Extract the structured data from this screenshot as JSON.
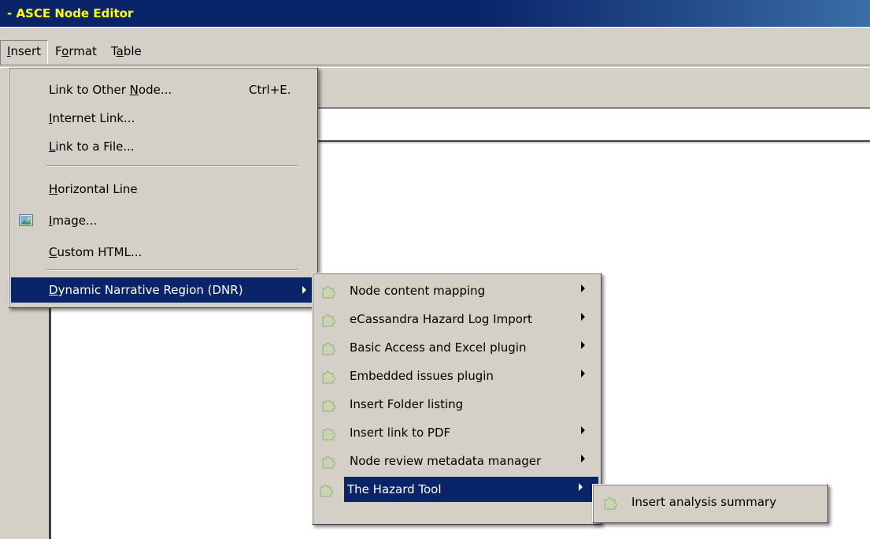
{
  "window": {
    "title": "- ASCE Node Editor"
  },
  "menubar": [
    {
      "label": "Insert",
      "mnemonic": "I",
      "rest": "nsert",
      "open": true
    },
    {
      "label": "Format",
      "pre": "F",
      "mnemonic": "o",
      "rest": "rmat",
      "open": false
    },
    {
      "label": "Table",
      "pre": "T",
      "mnemonic": "a",
      "rest": "ble",
      "open": false
    }
  ],
  "insert_menu": {
    "items": [
      {
        "pre": "Link to Other ",
        "mn": "N",
        "post": "ode...",
        "shortcut": "Ctrl+E."
      },
      {
        "pre": "",
        "mn": "I",
        "post": "nternet Link..."
      },
      {
        "pre": "",
        "mn": "L",
        "post": "ink to a File..."
      },
      {
        "pre": "",
        "mn": "H",
        "post": "orizontal Line"
      },
      {
        "pre": "",
        "mn": "I",
        "post": "mage...",
        "icon": "image-icon"
      },
      {
        "pre": "",
        "mn": "C",
        "post": "ustom HTML..."
      },
      {
        "pre": "",
        "mn": "D",
        "post": "ynamic Narrative Region (DNR)",
        "submenu": true,
        "selected": true
      }
    ]
  },
  "dnr_submenu": {
    "items": [
      {
        "label": "Node content mapping",
        "submenu": true
      },
      {
        "label": "eCassandra Hazard Log Import",
        "submenu": true
      },
      {
        "label": "Basic Access and Excel plugin",
        "submenu": true
      },
      {
        "label": "Embedded issues plugin",
        "submenu": true
      },
      {
        "label": "Insert Folder listing",
        "submenu": false
      },
      {
        "label": "Insert link to PDF",
        "submenu": true
      },
      {
        "label": "Node review metadata manager",
        "submenu": true
      },
      {
        "label": "The Hazard Tool",
        "submenu": true,
        "selected": true
      }
    ],
    "icon": "puzzle-plugin-icon"
  },
  "hazard_submenu": {
    "items": [
      {
        "label": "Insert analysis summary"
      }
    ]
  },
  "colors": {
    "titlebar": "#0a246a",
    "title_text": "#ffff00",
    "selection": "#0a246a",
    "face": "#d4d0c8"
  }
}
